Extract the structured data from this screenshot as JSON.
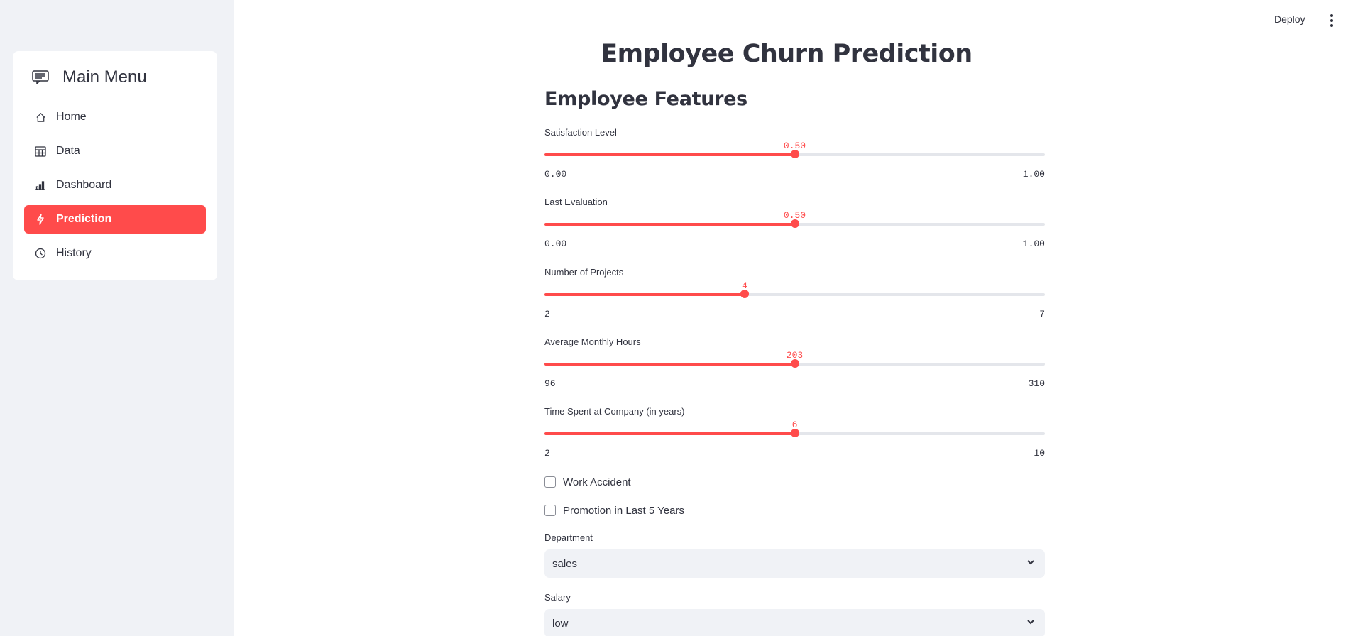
{
  "sidebar": {
    "menu_title": "Main Menu",
    "items": [
      {
        "label": "Home",
        "icon": "house-icon",
        "active": false
      },
      {
        "label": "Data",
        "icon": "table-icon",
        "active": false
      },
      {
        "label": "Dashboard",
        "icon": "bar-chart-icon",
        "active": false
      },
      {
        "label": "Prediction",
        "icon": "lightning-icon",
        "active": true
      },
      {
        "label": "History",
        "icon": "clock-icon",
        "active": false
      }
    ]
  },
  "header": {
    "deploy_label": "Deploy"
  },
  "main": {
    "title": "Employee Churn Prediction",
    "section_title": "Employee Features",
    "sliders": [
      {
        "label": "Satisfaction Level",
        "value": "0.50",
        "min": "0.00",
        "max": "1.00",
        "fraction": 0.5
      },
      {
        "label": "Last Evaluation",
        "value": "0.50",
        "min": "0.00",
        "max": "1.00",
        "fraction": 0.5
      },
      {
        "label": "Number of Projects",
        "value": "4",
        "min": "2",
        "max": "7",
        "fraction": 0.4
      },
      {
        "label": "Average Monthly Hours",
        "value": "203",
        "min": "96",
        "max": "310",
        "fraction": 0.5
      },
      {
        "label": "Time Spent at Company (in years)",
        "value": "6",
        "min": "2",
        "max": "10",
        "fraction": 0.5
      }
    ],
    "checkboxes": [
      {
        "label": "Work Accident",
        "checked": false
      },
      {
        "label": "Promotion in Last 5 Years",
        "checked": false
      }
    ],
    "selects": [
      {
        "label": "Department",
        "value": "sales"
      },
      {
        "label": "Salary",
        "value": "low"
      }
    ]
  },
  "colors": {
    "accent": "#ff4b4b",
    "sidebar_bg": "#f0f2f6",
    "text": "#31333f",
    "track": "#e4e6eb"
  }
}
